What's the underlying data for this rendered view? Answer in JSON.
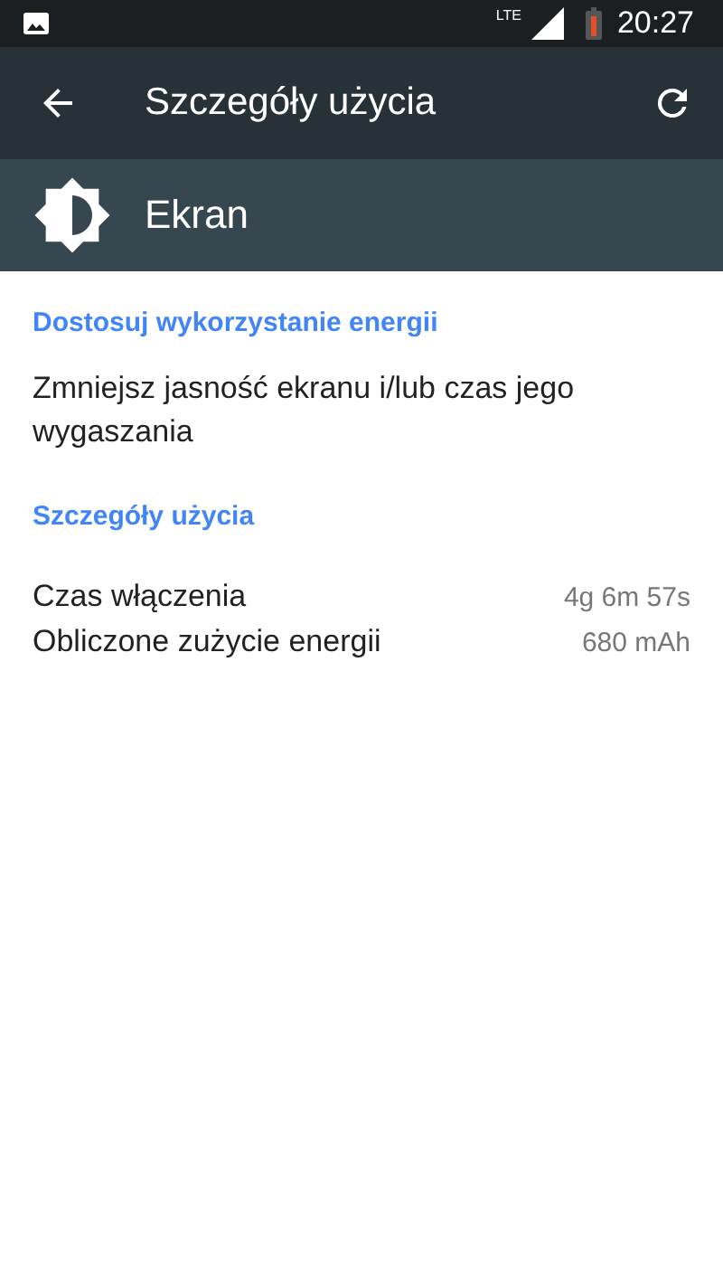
{
  "status_bar": {
    "network_label": "LTE",
    "time": "20:27"
  },
  "toolbar": {
    "title": "Szczegóły użycia"
  },
  "app_header": {
    "name": "Ekran"
  },
  "sections": [
    {
      "title": "Dostosuj wykorzystanie energii",
      "items": [
        {
          "kind": "text",
          "text": "Zmniejsz jasność ekranu i/lub czas jego wygaszania"
        }
      ]
    },
    {
      "title": "Szczegóły użycia",
      "items": [
        {
          "kind": "row",
          "label": "Czas włączenia",
          "value": "4g 6m 57s"
        },
        {
          "kind": "row",
          "label": "Obliczone zużycie energii",
          "value": "680 mAh"
        }
      ]
    }
  ]
}
